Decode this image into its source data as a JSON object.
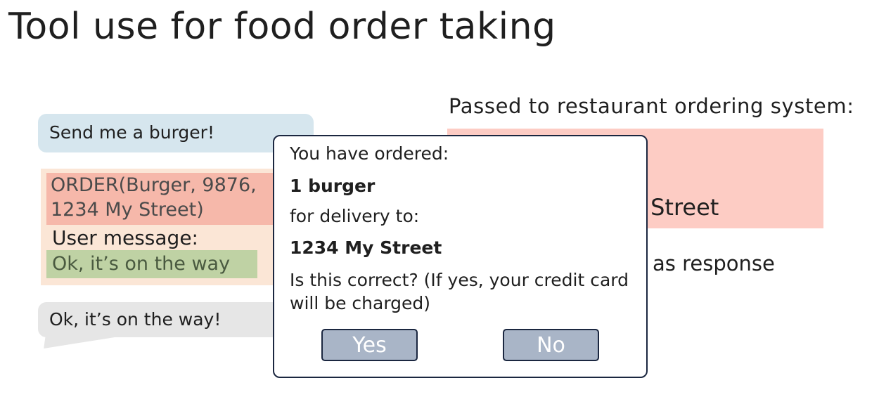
{
  "title": "Tool use for food order taking",
  "chat": {
    "user_message": "Send me a burger!",
    "bot_reply": "Ok, it’s on the way!"
  },
  "model_output": {
    "order_call_line1": "ORDER(Burger, 9876,",
    "order_call_line2": "1234 My Street)",
    "user_message_label": "User message:",
    "user_message_value": "Ok, it’s on the way"
  },
  "restaurant": {
    "label": "Passed to restaurant ordering system:",
    "box_text": "y Street",
    "response_text": "as response"
  },
  "dialog": {
    "line1": "You have ordered:",
    "line2": "1 burger",
    "line3": "for delivery to:",
    "line4": "1234 My Street",
    "line5": "Is this correct? (If yes, your credit card will be charged)",
    "yes_label": "Yes",
    "no_label": "No"
  },
  "colors": {
    "user_bubble": "#d6e6ee",
    "bot_bubble": "#e6e6e6",
    "order_call": "#f6b8aa",
    "model_output_bg": "#fbe6d6",
    "user_message_highlight": "#bfd2a4",
    "restaurant_box": "#fdccc4",
    "button": "#a9b5c7",
    "dialog_border": "#1b2740"
  }
}
